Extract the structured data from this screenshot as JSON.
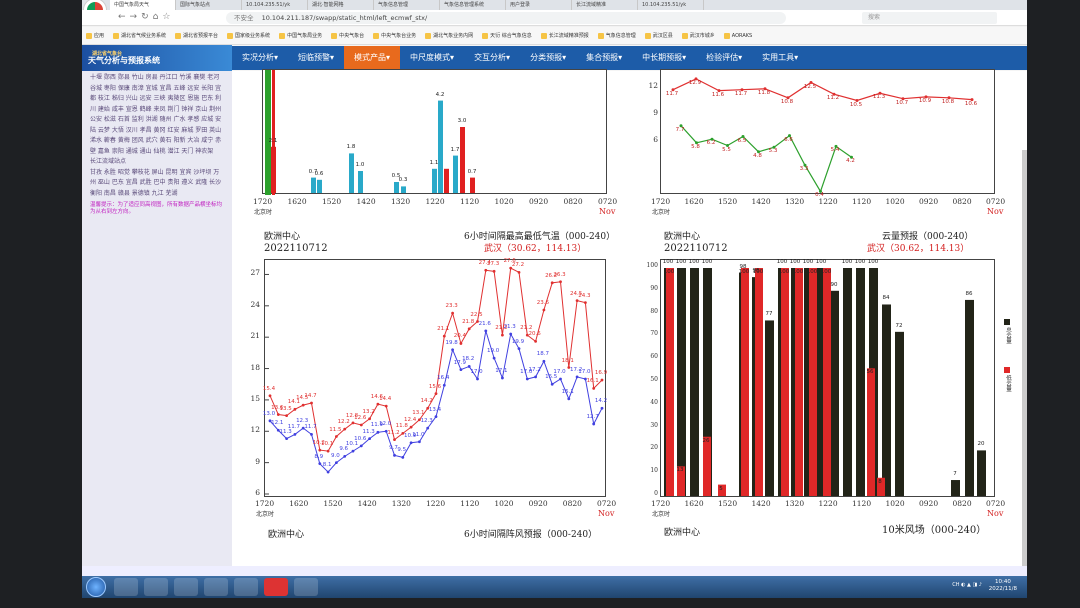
{
  "browser": {
    "tabs": [
      "中国气象局天气",
      "国际气象站点",
      "10.104.235.51/yk",
      "湖北·智能网格",
      "气象信息管理",
      "气象信息管理系统",
      "用户登录",
      "长江流域精准",
      "10.104.235.51/yk"
    ],
    "address_warning": "不安全",
    "url": "10.104.211.187/swapp/static_html/left_ecmwf_stx/",
    "search_placeholder": "搜索",
    "bookmarks": [
      "应用",
      "湖北省气候业务系统",
      "湖北省预报平台",
      "国家级业务系统",
      "中国气象局业务",
      "中央气象台",
      "中央气象台业务",
      "湖北气象业务内网",
      "天衍 综合气象信息",
      "长江流域精准预报",
      "气象信息管理",
      "武汉区县",
      "武汉市城乡",
      "AORAKS"
    ]
  },
  "app": {
    "logo_small": "湖北省气象台",
    "logo_title": "天气分析与预报系统",
    "menu": [
      "实况分析",
      "短临预警",
      "模式产品",
      "中尺度模式",
      "交互分析",
      "分类预报",
      "集合预报",
      "中长期预报",
      "检验评估",
      "实用工具"
    ],
    "active_menu": 2
  },
  "sidebar": {
    "cities": "十堰 郧西 郧县 竹山 房县 丹江口 竹溪 襄樊 老河 谷城 枣阳 保康 南漳 宜城 宜昌 五峰 远安 长阳 宜都 枝江 秭归 兴山 远安 三峡 夷陵区 恩施 巴东 利川 建始 咸丰 宣恩 鹤峰 来凤 荆门 钟祥 京山 荆州 公安 松滋 石首 监利 洪湖 随州 广水 孝感 应城 安陆 云梦 大悟 汉川 孝昌 黄冈 红安 麻城 罗田 英山 浠水 蕲春 黄梅 团风 武穴 黄石 阳新 大冶 咸宁 赤壁 嘉鱼 崇阳 通城 通山 仙桃 潜江 天门 神农架",
    "heading": "长江流域站点",
    "cities2": "甘孜 永胜 昭觉 攀枝花 屏山 昆明 宜宾 沙坪坝 万州 巫山 巴东 宜昌 武胜 巴中 贵阳 遵义 武隆 长沙 衡阳 南昌 赣县 景德镇 九江 芜湖",
    "note": "温馨提示：为了适应同高视图，所有数据产品横坐标均为从右到左方向。"
  },
  "charts": {
    "tl": {
      "xticks": [
        "1720",
        "1620",
        "1520",
        "1420",
        "1320",
        "1220",
        "1120",
        "1020",
        "0920",
        "0820",
        "0720"
      ],
      "xunit": "北京时",
      "nov": "Nov",
      "labels": [
        {
          "t": "2.1",
          "x": 8
        },
        {
          "t": "0.7",
          "x": 48
        },
        {
          "t": "0.6",
          "x": 54
        },
        {
          "t": "1.8",
          "x": 86
        },
        {
          "t": "1.0",
          "x": 95
        },
        {
          "t": "0.5",
          "x": 131
        },
        {
          "t": "0.3",
          "x": 138
        },
        {
          "t": "1.1",
          "x": 169
        },
        {
          "t": "4.2",
          "x": 175
        },
        {
          "t": "1.7",
          "x": 190
        },
        {
          "t": "3.0",
          "x": 197
        },
        {
          "t": "0.7",
          "x": 207
        }
      ]
    },
    "tr": {
      "xticks": [
        "1720",
        "1620",
        "1520",
        "1420",
        "1320",
        "1220",
        "1120",
        "1020",
        "0920",
        "0820",
        "0720"
      ],
      "xunit": "北京时",
      "nov": "Nov",
      "yticks": [
        "12",
        "9",
        "6"
      ],
      "labels_red": [
        "11.7",
        "12.9",
        "11.6",
        "11.7",
        "11.8",
        "10.8",
        "12.5",
        "11.2",
        "10.5",
        "11.3",
        "10.7",
        "10.9",
        "10.8",
        "10.6"
      ],
      "labels_green": [
        "7.7",
        "5.8",
        "6.2",
        "5.5",
        "6.5",
        "4.8",
        "5.3",
        "6.6",
        "3.3",
        "0.4",
        "5.4",
        "4.2"
      ]
    },
    "ml": {
      "center": "欧洲中心",
      "date": "2022110712",
      "title": "6小时间隔最高最低气温（000-240）",
      "location": "武汉（30.62，114.13）",
      "yticks": [
        "27",
        "24",
        "21",
        "18",
        "15",
        "12",
        "9",
        "6"
      ],
      "xticks": [
        "1720",
        "1620",
        "1520",
        "1420",
        "1320",
        "1220",
        "1120",
        "1020",
        "0920",
        "0820",
        "0720"
      ],
      "xunit": "北京时",
      "nov": "Nov"
    },
    "mr": {
      "center": "欧洲中心",
      "date": "2022110712",
      "title": "云量预报（000-240）",
      "location": "武汉（30.62，114.13）",
      "yticks": [
        "100",
        "90",
        "80",
        "70",
        "60",
        "50",
        "40",
        "30",
        "20",
        "10",
        "0"
      ],
      "xticks": [
        "1720",
        "1620",
        "1520",
        "1420",
        "1320",
        "1220",
        "1120",
        "1020",
        "0920",
        "0820",
        "0720"
      ],
      "xunit": "北京时",
      "nov": "Nov",
      "legend_total": "总云量",
      "legend_low": "低云量"
    },
    "bl": {
      "center": "欧洲中心",
      "title": "6小时间隔阵风预报（000-240）"
    },
    "br": {
      "center": "欧洲中心",
      "title": "10米风场（000-240）"
    }
  },
  "chart_data": [
    {
      "type": "bar",
      "title": "",
      "x": [
        "1720",
        "1620",
        "1520",
        "1420",
        "1320",
        "1220",
        "1120"
      ],
      "series": [
        {
          "name": "",
          "color": "#29a9c9",
          "values": [
            0.7,
            0.6,
            1.8,
            1.0,
            0.5,
            0.3,
            1.1,
            4.2,
            1.7
          ]
        },
        {
          "name": "",
          "color": "#e02020",
          "values": [
            2.1,
            1.1,
            3.0,
            0.7
          ]
        }
      ]
    },
    {
      "type": "line",
      "title": "",
      "series": [
        {
          "name": "",
          "color": "#e03030",
          "values": [
            11.7,
            12.9,
            11.6,
            11.7,
            11.8,
            10.8,
            12.5,
            11.2,
            10.5,
            11.3,
            10.7,
            10.9,
            10.8,
            10.6
          ]
        },
        {
          "name": "",
          "color": "#2ca02c",
          "values": [
            7.7,
            5.8,
            6.2,
            5.5,
            6.5,
            4.8,
            5.3,
            6.6,
            3.3,
            0.4,
            5.4,
            4.2
          ]
        }
      ]
    },
    {
      "type": "line",
      "title": "6小时间隔最高最低气温（000-240）",
      "ylim": [
        6,
        28
      ],
      "series": [
        {
          "name": "",
          "color": "#e03030",
          "values": [
            15.4,
            13.6,
            13.5,
            14.1,
            14.5,
            14.7,
            10.2,
            10.1,
            11.5,
            12.2,
            12.8,
            12.6,
            13.2,
            14.6,
            14.4,
            11.2,
            11.8,
            12.4,
            13.1,
            14.2,
            15.6,
            21.1,
            23.3,
            20.4,
            21.8,
            22.5,
            27.4,
            27.3,
            21.2,
            27.6,
            27.2,
            21.2,
            20.6,
            23.6,
            26.2,
            26.3,
            18.1,
            24.5,
            24.3,
            16.1,
            16.9
          ]
        },
        {
          "name": "",
          "color": "#4040e0",
          "values": [
            13.0,
            12.1,
            11.3,
            11.7,
            12.3,
            11.7,
            8.9,
            8.1,
            9.0,
            9.6,
            10.1,
            10.6,
            11.3,
            11.9,
            12.0,
            9.7,
            9.5,
            10.9,
            11.0,
            12.3,
            13.4,
            16.4,
            19.8,
            17.9,
            18.2,
            17.0,
            21.6,
            19.0,
            17.1,
            21.3,
            19.9,
            17.0,
            17.2,
            18.7,
            16.5,
            17.0,
            15.1,
            17.2,
            17.0,
            12.7,
            14.2
          ]
        }
      ]
    },
    {
      "type": "bar",
      "title": "云量预报（000-240）",
      "ylim": [
        0,
        100
      ],
      "series": [
        {
          "name": "总云量",
          "color": "#222418",
          "values": [
            100,
            100,
            100,
            100,
            98,
            96,
            77,
            100,
            100,
            100,
            100,
            90,
            100,
            100,
            100,
            84,
            72,
            7,
            86,
            20
          ]
        },
        {
          "name": "低云量",
          "color": "#e02828",
          "values": [
            100,
            13,
            26,
            5,
            100,
            100,
            100,
            100,
            100,
            100,
            56,
            8
          ]
        }
      ]
    }
  ]
}
